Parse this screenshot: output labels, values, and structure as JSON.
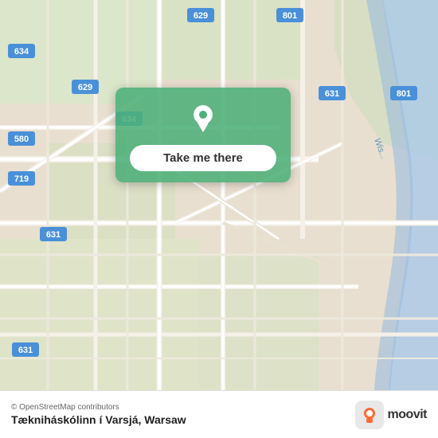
{
  "map": {
    "attribution": "© OpenStreetMap contributors",
    "bg_color": "#e8e0d8"
  },
  "overlay": {
    "button_label": "Take me there",
    "pin_color": "white"
  },
  "bottom_bar": {
    "copyright": "© OpenStreetMap contributors",
    "location_name": "Tækniháskólinn í Varsjá, Warsaw"
  },
  "moovit": {
    "wordmark": "moovit"
  },
  "road_labels": {
    "r1": "801",
    "r2": "629",
    "r3": "634",
    "r4": "580",
    "r5": "719",
    "r6": "631",
    "r7": "801"
  }
}
